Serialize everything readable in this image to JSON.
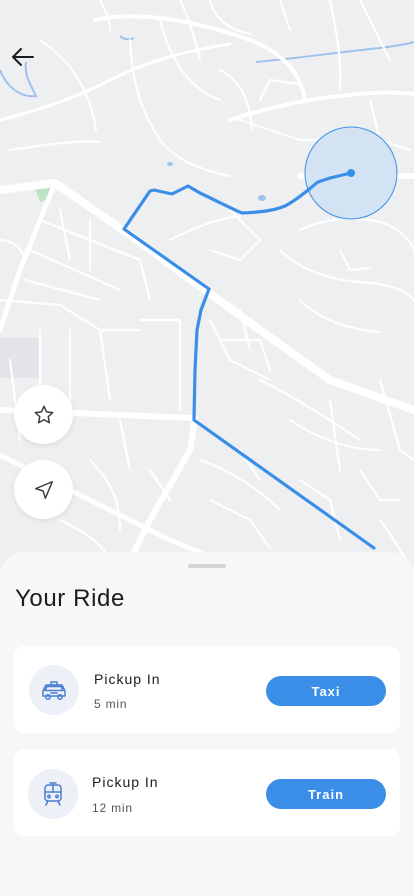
{
  "map": {
    "route_color": "#3a8ee8",
    "radius_color": "#cfe0f5"
  },
  "controls": {
    "back_icon": "arrow-left-icon",
    "favorite_icon": "star-icon",
    "locate_icon": "navigation-arrow-icon"
  },
  "sheet": {
    "title": "Your Ride",
    "rides": [
      {
        "icon": "taxi-icon",
        "title": "Pickup In",
        "eta": "5 min",
        "button": "Taxi"
      },
      {
        "icon": "train-icon",
        "title": "Pickup In",
        "eta": "12 min",
        "button": "Train"
      }
    ]
  },
  "colors": {
    "accent": "#3a8ee8",
    "card": "#ffffff",
    "sheet": "#f7f7f8"
  }
}
